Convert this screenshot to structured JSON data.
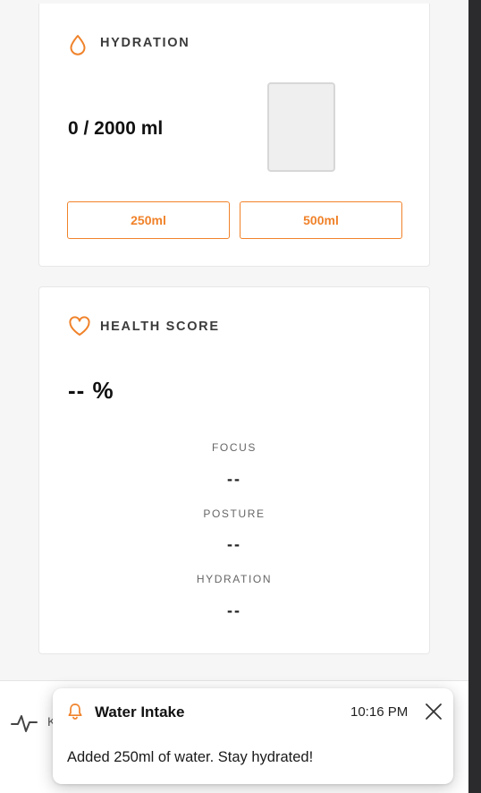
{
  "colors": {
    "accent": "#f0822a",
    "card_bg": "#ffffff",
    "page_bg": "#f6f6f6",
    "dark_strip": "#2b2b2d"
  },
  "hydration": {
    "title": "HYDRATION",
    "icon": "droplet-icon",
    "value": "0 / 2000 ml",
    "fill_fraction": 0,
    "buttons": [
      {
        "label": "250ml"
      },
      {
        "label": "500ml"
      }
    ]
  },
  "health_score": {
    "title": "HEALTH SCORE",
    "icon": "heart-icon",
    "score": "-- %",
    "metrics": [
      {
        "label": "FOCUS",
        "value": "--"
      },
      {
        "label": "POSTURE",
        "value": "--"
      },
      {
        "label": "HYDRATION",
        "value": "--"
      }
    ]
  },
  "bottom_bar": {
    "icon": "activity-icon",
    "partial_text": "K"
  },
  "notification": {
    "icon": "bell-icon",
    "title": "Water Intake",
    "time": "10:16 PM",
    "message": "Added 250ml of water. Stay hydrated!",
    "close_icon": "close-icon"
  }
}
